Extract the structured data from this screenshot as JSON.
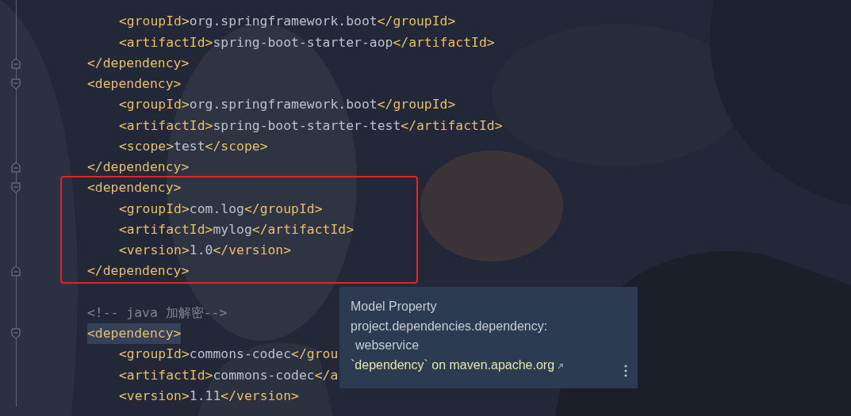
{
  "editor": {
    "items": [
      {
        "kind": "element",
        "boxed": false,
        "close": "</dependency>",
        "children": [
          {
            "segments": [
              {
                "kind": "tag",
                "text": "<groupId>"
              },
              {
                "kind": "text",
                "text": "org.springframework.boot"
              },
              {
                "kind": "tag",
                "text": "</groupId>"
              }
            ]
          },
          {
            "segments": [
              {
                "kind": "tag",
                "text": "<artifactId>"
              },
              {
                "kind": "text",
                "text": "spring-boot-starter-aop"
              },
              {
                "kind": "tag",
                "text": "</artifactId>"
              }
            ]
          }
        ]
      },
      {
        "kind": "element",
        "boxed": false,
        "highlighted": false,
        "open": "<dependency>",
        "close": "</dependency>",
        "children": [
          {
            "segments": [
              {
                "kind": "tag",
                "text": "<groupId>"
              },
              {
                "kind": "text",
                "text": "org.springframework.boot"
              },
              {
                "kind": "tag",
                "text": "</groupId>"
              }
            ]
          },
          {
            "segments": [
              {
                "kind": "tag",
                "text": "<artifactId>"
              },
              {
                "kind": "text",
                "text": "spring-boot-starter-test"
              },
              {
                "kind": "tag",
                "text": "</artifactId>"
              }
            ]
          },
          {
            "segments": [
              {
                "kind": "tag",
                "text": "<scope>"
              },
              {
                "kind": "text",
                "text": "test"
              },
              {
                "kind": "tag",
                "text": "</scope>"
              }
            ]
          }
        ]
      },
      {
        "kind": "element",
        "boxed": true,
        "highlighted": false,
        "open": "<dependency>",
        "close": "</dependency>",
        "children": [
          {
            "segments": [
              {
                "kind": "tag",
                "text": "<groupId>"
              },
              {
                "kind": "text",
                "text": "com.log"
              },
              {
                "kind": "tag",
                "text": "</groupId>"
              }
            ]
          },
          {
            "segments": [
              {
                "kind": "tag",
                "text": "<artifactId>"
              },
              {
                "kind": "text",
                "text": "mylog"
              },
              {
                "kind": "tag",
                "text": "</artifactId>"
              }
            ]
          },
          {
            "segments": [
              {
                "kind": "tag",
                "text": "<version>"
              },
              {
                "kind": "text",
                "text": "1.0"
              },
              {
                "kind": "tag",
                "text": "</version>"
              }
            ]
          }
        ]
      },
      {
        "kind": "blank"
      },
      {
        "kind": "comment",
        "text": "<!-- java 加解密-->"
      },
      {
        "kind": "element",
        "boxed": false,
        "highlighted": true,
        "open": "<dependency>",
        "children": [
          {
            "segments": [
              {
                "kind": "tag",
                "text": "<groupId>"
              },
              {
                "kind": "text",
                "text": "commons-codec"
              },
              {
                "kind": "tag",
                "text": "</grou"
              }
            ]
          },
          {
            "segments": [
              {
                "kind": "tag",
                "text": "<artifactId>"
              },
              {
                "kind": "text",
                "text": "commons-codec"
              },
              {
                "kind": "tag",
                "text": "</a"
              }
            ]
          },
          {
            "segments": [
              {
                "kind": "tag",
                "text": "<version>"
              },
              {
                "kind": "text",
                "text": "1.11"
              },
              {
                "kind": "tag",
                "text": "</version>"
              }
            ]
          }
        ]
      }
    ]
  },
  "tooltip": {
    "title": "Model Property",
    "path": "project.dependencies.dependency:",
    "value": "webservice",
    "link": "`dependency` on maven.apache.org"
  }
}
